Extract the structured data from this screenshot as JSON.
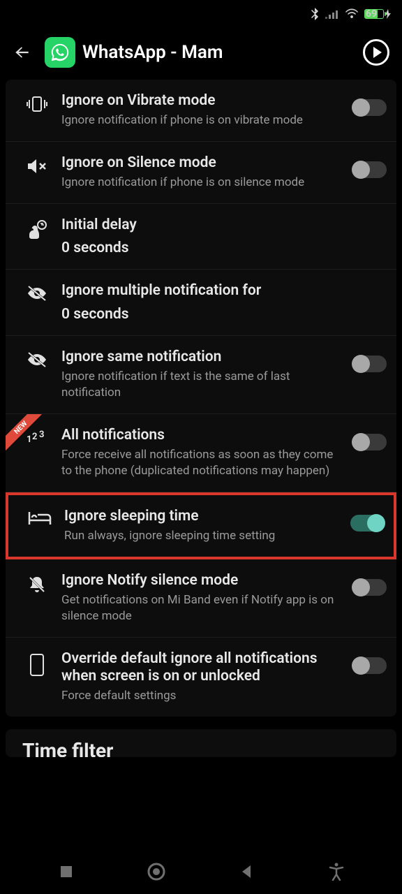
{
  "status": {
    "battery": "69"
  },
  "header": {
    "title": "WhatsApp - Mam"
  },
  "rows": {
    "vibrate": {
      "title": "Ignore on Vibrate mode",
      "sub": "Ignore notification if phone is on vibrate mode",
      "on": false
    },
    "silence": {
      "title": "Ignore on Silence mode",
      "sub": "Ignore notification if phone is on silence mode",
      "on": false
    },
    "delay": {
      "title": "Initial delay",
      "value": "0 seconds"
    },
    "multiple": {
      "title": "Ignore multiple notification for",
      "value": "0 seconds"
    },
    "same": {
      "title": "Ignore same notification",
      "sub": "Ignore notification if text is the same of last notification",
      "on": false
    },
    "all": {
      "title": "All notifications",
      "sub": "Force receive all notifications as soon as they come to the phone (duplicated notifications may happen)",
      "on": false,
      "badge": "NEW"
    },
    "sleep": {
      "title": "Ignore sleeping time",
      "sub": "Run always, ignore sleeping time setting",
      "on": true
    },
    "notify": {
      "title": "Ignore Notify silence mode",
      "sub": "Get notifications on Mi Band even if Notify app is on silence mode",
      "on": false
    },
    "override": {
      "title": "Override default ignore all notifications when screen is on or unlocked",
      "sub": "Force default settings",
      "on": false
    }
  },
  "next_section": "Time filter"
}
